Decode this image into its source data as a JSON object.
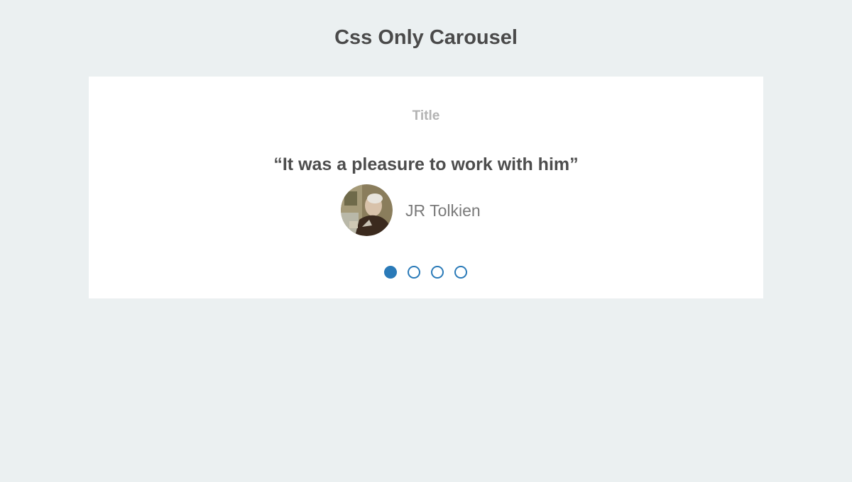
{
  "page": {
    "title": "Css Only Carousel"
  },
  "carousel": {
    "slide": {
      "title": "Title",
      "quote": "“It was a pleasure to work with him”",
      "author": "JR Tolkien"
    },
    "dots": [
      {
        "active": true
      },
      {
        "active": false
      },
      {
        "active": false
      },
      {
        "active": false
      }
    ],
    "accent_color": "#2a7ab8"
  }
}
